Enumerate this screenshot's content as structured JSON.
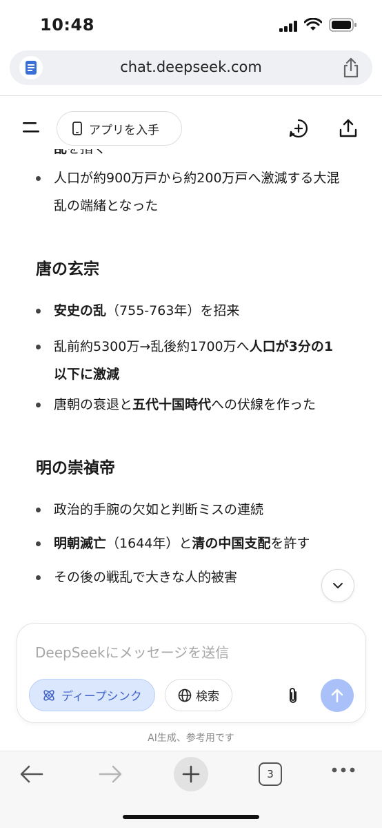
{
  "status_bar": {
    "time": "10:48"
  },
  "browser": {
    "url": "chat.deepseek.com",
    "tab_count": "3"
  },
  "app_header": {
    "get_app_label": "アプリを入手"
  },
  "chat": {
    "top_fragment_bold": "乱",
    "top_fragment_rest": "を指く",
    "bullet_top": "人口が約900万戸から約200万戸へ激減する大混乱の端緒となった",
    "section1": {
      "heading": "唐の玄宗",
      "b1_bold": "安史の乱",
      "b1_rest": "（755-763年）を招来",
      "b2_pre": "乱前約5300万→乱後約1700万へ",
      "b2_bold": "人口が3分の1以下に激減",
      "b3_pre": "唐朝の衰退と",
      "b3_bold": "五代十国時代",
      "b3_rest": "への伏線を作った"
    },
    "section2": {
      "heading": "明の崇禎帝",
      "b1": "政治的手腕の欠如と判断ミスの連続",
      "b2_bold1": "明朝滅亡",
      "b2_mid": "（1644年）と",
      "b2_bold2": "清の中国支配",
      "b2_rest": "を許す",
      "b3": "その後の戦乱で大きな人的被害"
    }
  },
  "composer": {
    "placeholder": "DeepSeekにメッセージを送信",
    "deepthink_label": "ディープシンク",
    "search_label": "検索"
  },
  "disclaimer": "AI生成、参考用です",
  "colors": {
    "accent": "#4264c9",
    "send_button": "#a9c1f8",
    "deepthink_bg": "#dbe7fd"
  },
  "icons": [
    "signal-icon",
    "wifi-icon",
    "battery-icon",
    "page-icon",
    "share-icon",
    "menu-icon",
    "phone-icon",
    "new-chat-icon",
    "chevron-down-icon",
    "atom-icon",
    "globe-icon",
    "paperclip-icon",
    "send-arrow-icon",
    "back-icon",
    "forward-icon",
    "plus-icon",
    "tabs-icon",
    "more-icon"
  ]
}
